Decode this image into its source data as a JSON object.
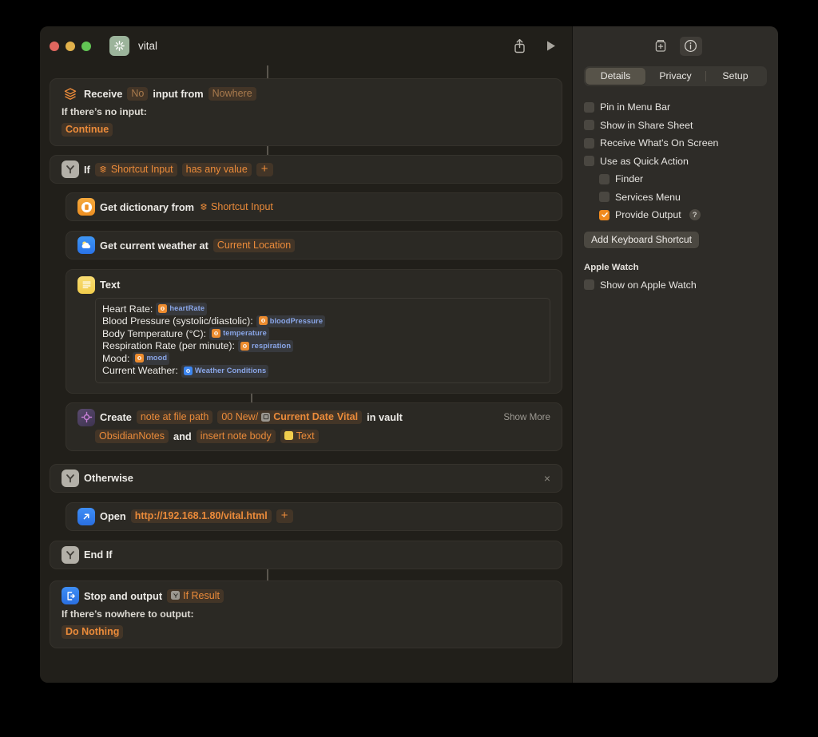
{
  "window": {
    "title": "vital",
    "app_icon": "shortcuts-sparkle-icon",
    "traffic_lights": [
      "close",
      "minimize",
      "zoom"
    ],
    "toolbar": {
      "share_label": "Share",
      "run_label": "Run"
    }
  },
  "sidebar": {
    "toolbar": {
      "icon_button_label": "Add Icon",
      "info_button_label": "Info"
    },
    "tabs": [
      {
        "label": "Details",
        "active": true
      },
      {
        "label": "Privacy",
        "active": false
      },
      {
        "label": "Setup",
        "active": false
      }
    ],
    "options": [
      {
        "label": "Pin in Menu Bar",
        "checked": false,
        "sub": false
      },
      {
        "label": "Show in Share Sheet",
        "checked": false,
        "sub": false
      },
      {
        "label": "Receive What's On Screen",
        "checked": false,
        "sub": false
      },
      {
        "label": "Use as Quick Action",
        "checked": false,
        "sub": false
      },
      {
        "label": "Finder",
        "checked": false,
        "sub": true
      },
      {
        "label": "Services Menu",
        "checked": false,
        "sub": true
      },
      {
        "label": "Provide Output",
        "checked": true,
        "sub": true,
        "help": "?"
      }
    ],
    "keyboard_shortcut_button": "Add Keyboard Shortcut",
    "apple_watch_header": "Apple Watch",
    "apple_watch_option": {
      "label": "Show on Apple Watch",
      "checked": false
    }
  },
  "actions": {
    "receive": {
      "icon": "receive-input-icon",
      "label": "Receive",
      "chip_no": "No",
      "mid": "input from",
      "chip_nowhere": "Nowhere",
      "body_label": "If there’s no input:",
      "body_chip": "Continue"
    },
    "if": {
      "icon": "if-branch-icon",
      "label": "If",
      "chip_input": "Shortcut Input",
      "chip_condition": "has any value",
      "chip_plus": "+"
    },
    "get_dictionary": {
      "icon": "dictionary-icon",
      "label": "Get dictionary from",
      "chip_input": "Shortcut Input"
    },
    "get_weather": {
      "icon": "weather-icon",
      "label": "Get current weather at",
      "chip_location": "Current Location"
    },
    "text": {
      "icon": "text-icon",
      "label": "Text",
      "lines": [
        {
          "text": "Heart Rate: ",
          "var": "heartRate",
          "var_icon_color": "#ec8b2e"
        },
        {
          "text": "Blood Pressure (systolic/diastolic): ",
          "var": "bloodPressure",
          "var_icon_color": "#ec8b2e"
        },
        {
          "text": "Body Temperature (°C): ",
          "var": "temperature",
          "var_icon_color": "#ec8b2e"
        },
        {
          "text": "Respiration Rate (per minute): ",
          "var": "respiration",
          "var_icon_color": "#ec8b2e"
        },
        {
          "text": "Mood: ",
          "var": "mood",
          "var_icon_color": "#ec8b2e"
        },
        {
          "text": "Current Weather: ",
          "var": "Weather Conditions",
          "var_icon_color": "#3d86f0"
        }
      ]
    },
    "create_note": {
      "icon": "obsidian-icon",
      "label": "Create",
      "chip_path_label": "note at file path",
      "chip_path_prefix": "00 New/",
      "chip_path_var": "Current Date",
      "chip_path_suffix": "Vital",
      "mid_in_vault": "in vault",
      "show_more": "Show More",
      "chip_vault": "ObsidianNotes",
      "mid_and": "and",
      "chip_insert": "insert note body",
      "chip_text_var": "Text"
    },
    "otherwise": {
      "icon": "if-branch-icon",
      "label": "Otherwise",
      "close": "×"
    },
    "open_url": {
      "icon": "open-url-icon",
      "label": "Open",
      "chip_url": "http://192.168.1.80/vital.html",
      "chip_plus": "+"
    },
    "end_if": {
      "icon": "if-branch-icon",
      "label": "End If"
    },
    "stop_output": {
      "icon": "stop-output-icon",
      "label": "Stop and output",
      "chip_result": "If Result",
      "body_label": "If there’s nowhere to output:",
      "body_chip": "Do Nothing"
    }
  },
  "colors": {
    "canvas": "#211f1a",
    "card": "#2b2924",
    "sidebar": "#2e2c28",
    "accent_orange": "#eb8b3a",
    "checkbox_on": "#f08a1e",
    "variable_blue": "#8aa6e8"
  }
}
